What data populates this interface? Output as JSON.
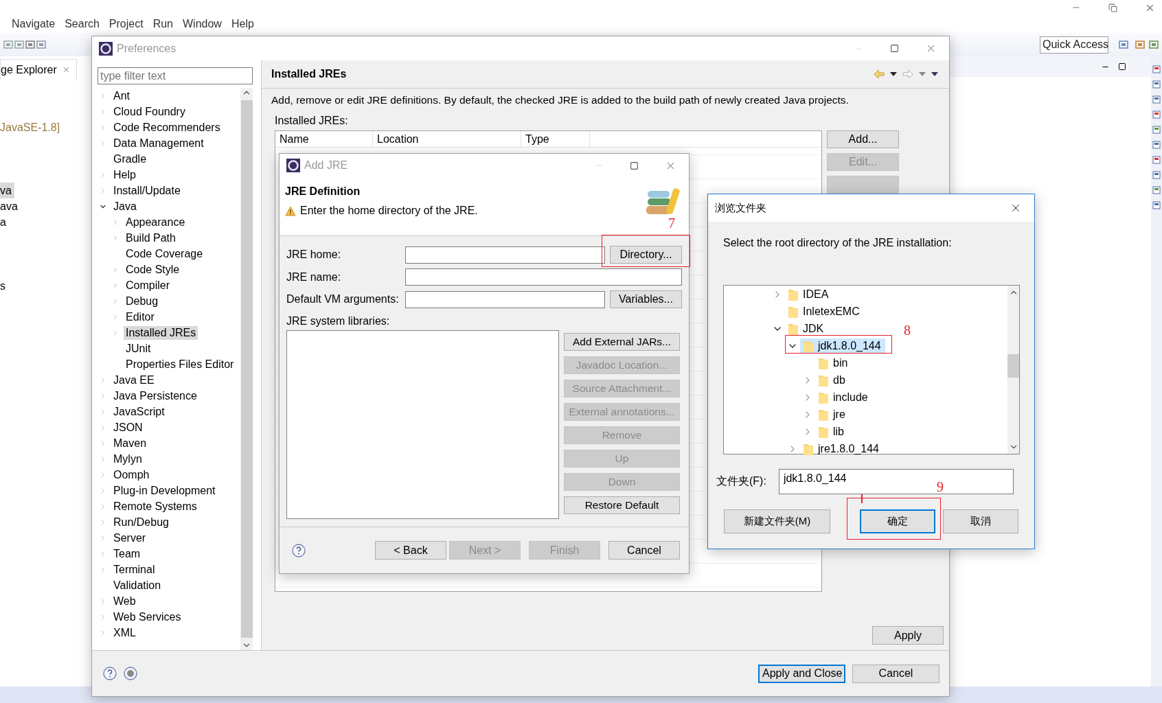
{
  "menu_bar": {
    "items": [
      "Navigate",
      "Search",
      "Project",
      "Run",
      "Window",
      "Help"
    ]
  },
  "toolbar": {
    "quick_access": "Quick Access"
  },
  "package_explorer": {
    "tab": "ge Explorer",
    "lines": [
      {
        "text": "JavaSE-1.8]",
        "kind": "library",
        "selected": false
      },
      {
        "text": "va",
        "kind": "file",
        "selected": true
      },
      {
        "text": "ava",
        "kind": "file",
        "selected": false
      },
      {
        "text": "a",
        "kind": "file",
        "selected": false
      },
      {
        "text": "s",
        "kind": "file",
        "selected": false
      }
    ]
  },
  "preferences": {
    "title": "Preferences",
    "filter": {
      "placeholder": "type filter text"
    },
    "tree": [
      {
        "label": "Ant",
        "expandable": true,
        "expanded": false,
        "selected": false
      },
      {
        "label": "Cloud Foundry",
        "expandable": true,
        "expanded": false,
        "selected": false
      },
      {
        "label": "Code Recommenders",
        "expandable": true,
        "expanded": false,
        "selected": false
      },
      {
        "label": "Data Management",
        "expandable": true,
        "expanded": false,
        "selected": false
      },
      {
        "label": "Gradle",
        "expandable": false,
        "selected": false
      },
      {
        "label": "Help",
        "expandable": true,
        "expanded": false,
        "selected": false
      },
      {
        "label": "Install/Update",
        "expandable": true,
        "expanded": false,
        "selected": false
      },
      {
        "label": "Java",
        "expandable": true,
        "expanded": true,
        "selected": false,
        "children": [
          {
            "label": "Appearance",
            "expandable": true,
            "expanded": false,
            "selected": false
          },
          {
            "label": "Build Path",
            "expandable": true,
            "expanded": false,
            "selected": false
          },
          {
            "label": "Code Coverage",
            "expandable": false,
            "selected": false
          },
          {
            "label": "Code Style",
            "expandable": true,
            "expanded": false,
            "selected": false
          },
          {
            "label": "Compiler",
            "expandable": true,
            "expanded": false,
            "selected": false
          },
          {
            "label": "Debug",
            "expandable": true,
            "expanded": false,
            "selected": false
          },
          {
            "label": "Editor",
            "expandable": true,
            "expanded": false,
            "selected": false
          },
          {
            "label": "Installed JREs",
            "expandable": true,
            "expanded": false,
            "selected": true
          },
          {
            "label": "JUnit",
            "expandable": false,
            "selected": false
          },
          {
            "label": "Properties Files Editor",
            "expandable": false,
            "selected": false
          }
        ]
      },
      {
        "label": "Java EE",
        "expandable": true,
        "expanded": false,
        "selected": false
      },
      {
        "label": "Java Persistence",
        "expandable": true,
        "expanded": false,
        "selected": false
      },
      {
        "label": "JavaScript",
        "expandable": true,
        "expanded": false,
        "selected": false
      },
      {
        "label": "JSON",
        "expandable": true,
        "expanded": false,
        "selected": false
      },
      {
        "label": "Maven",
        "expandable": true,
        "expanded": false,
        "selected": false
      },
      {
        "label": "Mylyn",
        "expandable": true,
        "expanded": false,
        "selected": false
      },
      {
        "label": "Oomph",
        "expandable": true,
        "expanded": false,
        "selected": false
      },
      {
        "label": "Plug-in Development",
        "expandable": true,
        "expanded": false,
        "selected": false
      },
      {
        "label": "Remote Systems",
        "expandable": true,
        "expanded": false,
        "selected": false
      },
      {
        "label": "Run/Debug",
        "expandable": true,
        "expanded": false,
        "selected": false
      },
      {
        "label": "Server",
        "expandable": true,
        "expanded": false,
        "selected": false
      },
      {
        "label": "Team",
        "expandable": true,
        "expanded": false,
        "selected": false
      },
      {
        "label": "Terminal",
        "expandable": true,
        "expanded": false,
        "selected": false
      },
      {
        "label": "Validation",
        "expandable": false,
        "selected": false
      },
      {
        "label": "Web",
        "expandable": true,
        "expanded": false,
        "selected": false
      },
      {
        "label": "Web Services",
        "expandable": true,
        "expanded": false,
        "selected": false
      },
      {
        "label": "XML",
        "expandable": true,
        "expanded": false,
        "selected": false
      }
    ],
    "page": {
      "title": "Installed JREs",
      "description": "Add, remove or edit JRE definitions. By default, the checked JRE is added to the build path of newly created Java projects.",
      "table_label": "Installed JREs:",
      "columns": [
        "Name",
        "Location",
        "Type"
      ],
      "buttons": [
        {
          "label": "Add...",
          "disabled": false
        },
        {
          "label": "Edit...",
          "disabled": true
        }
      ],
      "apply": "Apply"
    },
    "footer_buttons": [
      {
        "label": "Apply and Close",
        "default": true
      },
      {
        "label": "Cancel",
        "default": false
      }
    ]
  },
  "add_jre": {
    "title": "Add JRE",
    "heading": "JRE Definition",
    "message": "Enter the home directory of the JRE.",
    "fields": [
      {
        "label": "JRE home:",
        "button": "Directory..."
      },
      {
        "label": "JRE name:"
      },
      {
        "label": "Default VM arguments:",
        "button": "Variables..."
      }
    ],
    "libraries_label": "JRE system libraries:",
    "library_buttons": [
      {
        "label": "Add External JARs...",
        "disabled": false
      },
      {
        "label": "Javadoc Location...",
        "disabled": true
      },
      {
        "label": "Source Attachment...",
        "disabled": true
      },
      {
        "label": "External annotations...",
        "disabled": true
      },
      {
        "label": "Remove",
        "disabled": true
      },
      {
        "label": "Up",
        "disabled": true
      },
      {
        "label": "Down",
        "disabled": true
      },
      {
        "label": "Restore Default",
        "disabled": false
      }
    ],
    "nav_buttons": [
      {
        "label": "< Back",
        "disabled": false
      },
      {
        "label": "Next >",
        "disabled": true
      },
      {
        "label": "Finish",
        "disabled": true
      },
      {
        "label": "Cancel",
        "disabled": false
      }
    ]
  },
  "browse_folder": {
    "title": "浏览文件夹",
    "instruction": "Select the root directory of the JRE installation:",
    "tree": [
      {
        "label": "IDEA",
        "expandable": true,
        "expanded": false,
        "selected": false
      },
      {
        "label": "InletexEMC",
        "expandable": false,
        "selected": false
      },
      {
        "label": "JDK",
        "expandable": true,
        "expanded": true,
        "selected": false,
        "children": [
          {
            "label": "jdk1.8.0_144",
            "expandable": true,
            "expanded": true,
            "selected": true,
            "children": [
              {
                "label": "bin",
                "expandable": false,
                "selected": false
              },
              {
                "label": "db",
                "expandable": true,
                "expanded": false,
                "selected": false
              },
              {
                "label": "include",
                "expandable": true,
                "expanded": false,
                "selected": false
              },
              {
                "label": "jre",
                "expandable": true,
                "expanded": false,
                "selected": false
              },
              {
                "label": "lib",
                "expandable": true,
                "expanded": false,
                "selected": false
              }
            ]
          },
          {
            "label": "jre1.8.0_144",
            "expandable": true,
            "expanded": false,
            "selected": false
          }
        ]
      }
    ],
    "folder_label": "文件夹(F):",
    "folder_value": "jdk1.8.0_144",
    "buttons": [
      {
        "label": "新建文件夹(M)",
        "default": false
      },
      {
        "label": "确定",
        "default": true
      },
      {
        "label": "取消",
        "default": false
      }
    ]
  },
  "annotations": [
    "7",
    "8",
    "9"
  ]
}
